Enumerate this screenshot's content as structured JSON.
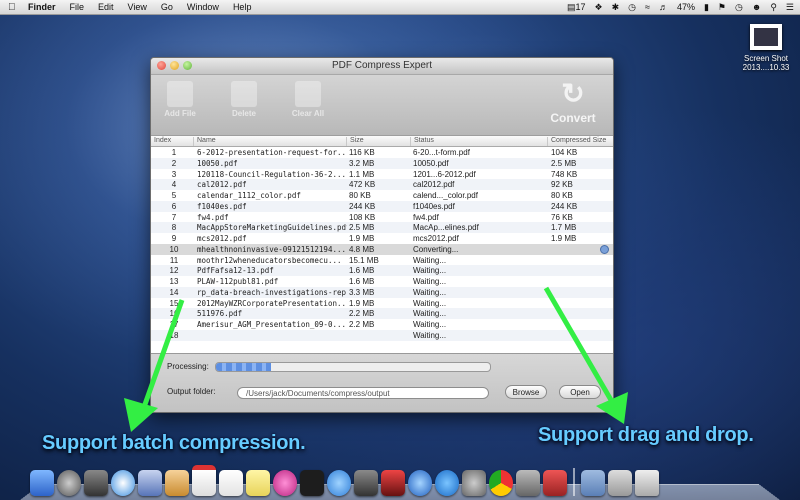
{
  "menubar": {
    "app": "Finder",
    "items": [
      "File",
      "Edit",
      "View",
      "Go",
      "Window",
      "Help"
    ],
    "status": {
      "date_num": "17",
      "battery": "47%"
    }
  },
  "desktop_icon": {
    "label1": "Screen Shot",
    "label2": "2013....10.33"
  },
  "window": {
    "title": "PDF Compress Expert",
    "toolbar": {
      "add": "Add File",
      "delete": "Delete",
      "clear": "Clear All",
      "convert": "Convert"
    },
    "columns": {
      "index": "Index",
      "name": "Name",
      "size": "Size",
      "status": "Status",
      "compressed": "Compressed Size"
    },
    "rows": [
      {
        "idx": "1",
        "name": "6-2012-presentation-request-for...",
        "size": "116 KB",
        "status": "6-20...t-form.pdf",
        "comp": "104 KB"
      },
      {
        "idx": "2",
        "name": "10050.pdf",
        "size": "3.2 MB",
        "status": "10050.pdf",
        "comp": "2.5 MB"
      },
      {
        "idx": "3",
        "name": "120118-Council-Regulation-36-2...",
        "size": "1.1 MB",
        "status": "1201...6-2012.pdf",
        "comp": "748 KB"
      },
      {
        "idx": "4",
        "name": "cal2012.pdf",
        "size": "472 KB",
        "status": "cal2012.pdf",
        "comp": "92 KB"
      },
      {
        "idx": "5",
        "name": "calendar_1112_color.pdf",
        "size": "80 KB",
        "status": "calend..._color.pdf",
        "comp": "80 KB"
      },
      {
        "idx": "6",
        "name": "f1040es.pdf",
        "size": "244 KB",
        "status": "f1040es.pdf",
        "comp": "244 KB"
      },
      {
        "idx": "7",
        "name": "fw4.pdf",
        "size": "108 KB",
        "status": "fw4.pdf",
        "comp": "76 KB"
      },
      {
        "idx": "8",
        "name": "MacAppStoreMarketingGuidelines.pdf",
        "size": "2.5 MB",
        "status": "MacAp...elines.pdf",
        "comp": "1.7 MB"
      },
      {
        "idx": "9",
        "name": "mcs2012.pdf",
        "size": "1.9 MB",
        "status": "mcs2012.pdf",
        "comp": "1.9 MB"
      },
      {
        "idx": "10",
        "name": "mhealthnoninvasive-09121512194...",
        "size": "4.8 MB",
        "status": "Converting...",
        "comp": ""
      },
      {
        "idx": "11",
        "name": "moothr12wheneducatorsbecomecu...",
        "size": "15.1 MB",
        "status": "Waiting...",
        "comp": ""
      },
      {
        "idx": "12",
        "name": "PdfFafsa12-13.pdf",
        "size": "1.6 MB",
        "status": "Waiting...",
        "comp": ""
      },
      {
        "idx": "13",
        "name": "PLAW-112publ81.pdf",
        "size": "1.6 MB",
        "status": "Waiting...",
        "comp": ""
      },
      {
        "idx": "14",
        "name": "rp_data-breach-investigations-rep...",
        "size": "3.3 MB",
        "status": "Waiting...",
        "comp": ""
      },
      {
        "idx": "15",
        "name": "2012MayWZRCorporatePresentation...",
        "size": "1.9 MB",
        "status": "Waiting...",
        "comp": ""
      },
      {
        "idx": "16",
        "name": "511976.pdf",
        "size": "2.2 MB",
        "status": "Waiting...",
        "comp": ""
      },
      {
        "idx": "17",
        "name": "Amerisur_AGM_Presentation_09-0...",
        "size": "2.2 MB",
        "status": "Waiting...",
        "comp": ""
      },
      {
        "idx": "18",
        "name": "",
        "size": "",
        "status": "Waiting...",
        "comp": ""
      }
    ],
    "processing_label": "Processing:",
    "progress_fraction": 0.2,
    "output_label": "Output folder:",
    "output_path": "/Users/jack/Documents/compress/output",
    "browse": "Browse",
    "open": "Open"
  },
  "callouts": {
    "left": "Support batch compression.",
    "right": "Support drag and drop."
  },
  "colors": {
    "arrow": "#33ee44",
    "callout_text": "#66ccff"
  }
}
